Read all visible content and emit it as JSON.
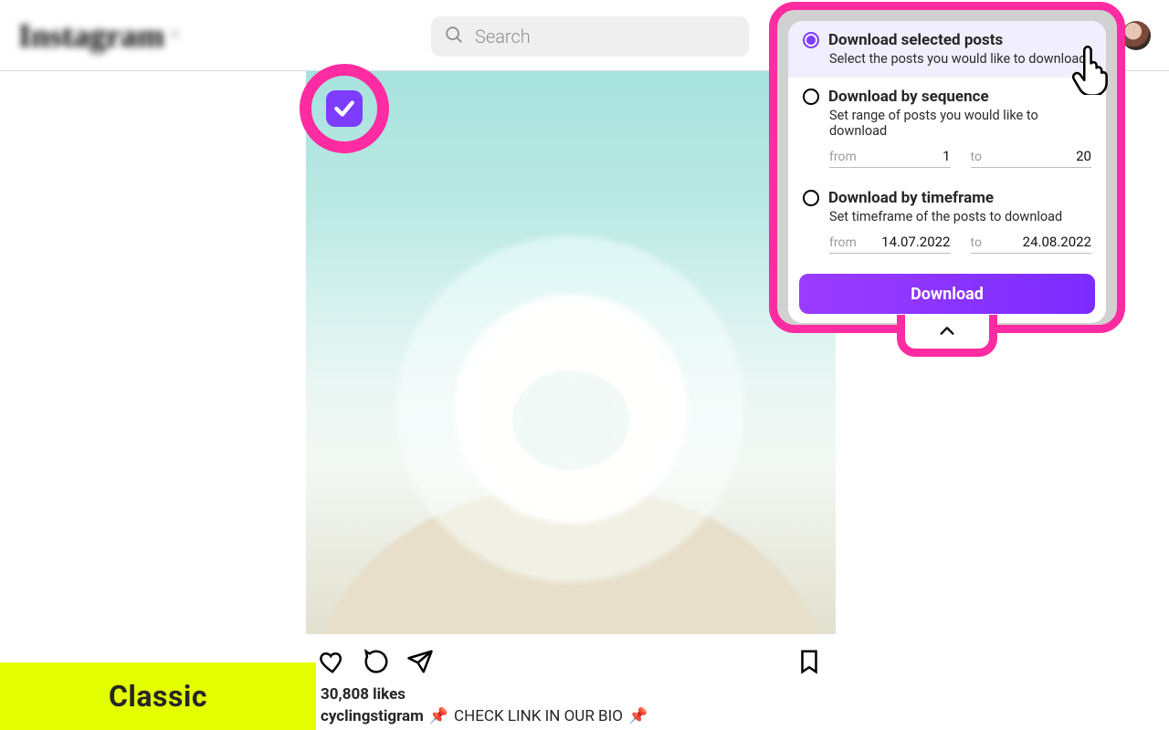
{
  "header": {
    "logo_text": "Instagram",
    "search_placeholder": "Search"
  },
  "icons": {
    "home": "home-icon",
    "messenger": "messenger-icon",
    "create": "plus-square-icon",
    "explore": "compass-icon",
    "activity": "heart-icon",
    "download": "download-arrow-icon",
    "avatar": "avatar"
  },
  "post": {
    "likes_text": "30,808 likes",
    "username": "cyclingstigram",
    "caption_text": "CHECK LINK IN OUR BIO",
    "emoji": "📌"
  },
  "panel": {
    "opt_selected": {
      "title": "Download selected posts",
      "subtitle": "Select the posts you would like to download"
    },
    "opt_sequence": {
      "title": "Download by sequence",
      "subtitle": "Set range of posts you would like to download",
      "from_label": "from",
      "from_value": "1",
      "to_label": "to",
      "to_value": "20"
    },
    "opt_timeframe": {
      "title": "Download by timeframe",
      "subtitle": "Set timeframe of the posts to download",
      "from_label": "from",
      "from_value": "14.07.2022",
      "to_label": "to",
      "to_value": "24.08.2022"
    },
    "download_button": "Download"
  },
  "classic_label": "Classic"
}
